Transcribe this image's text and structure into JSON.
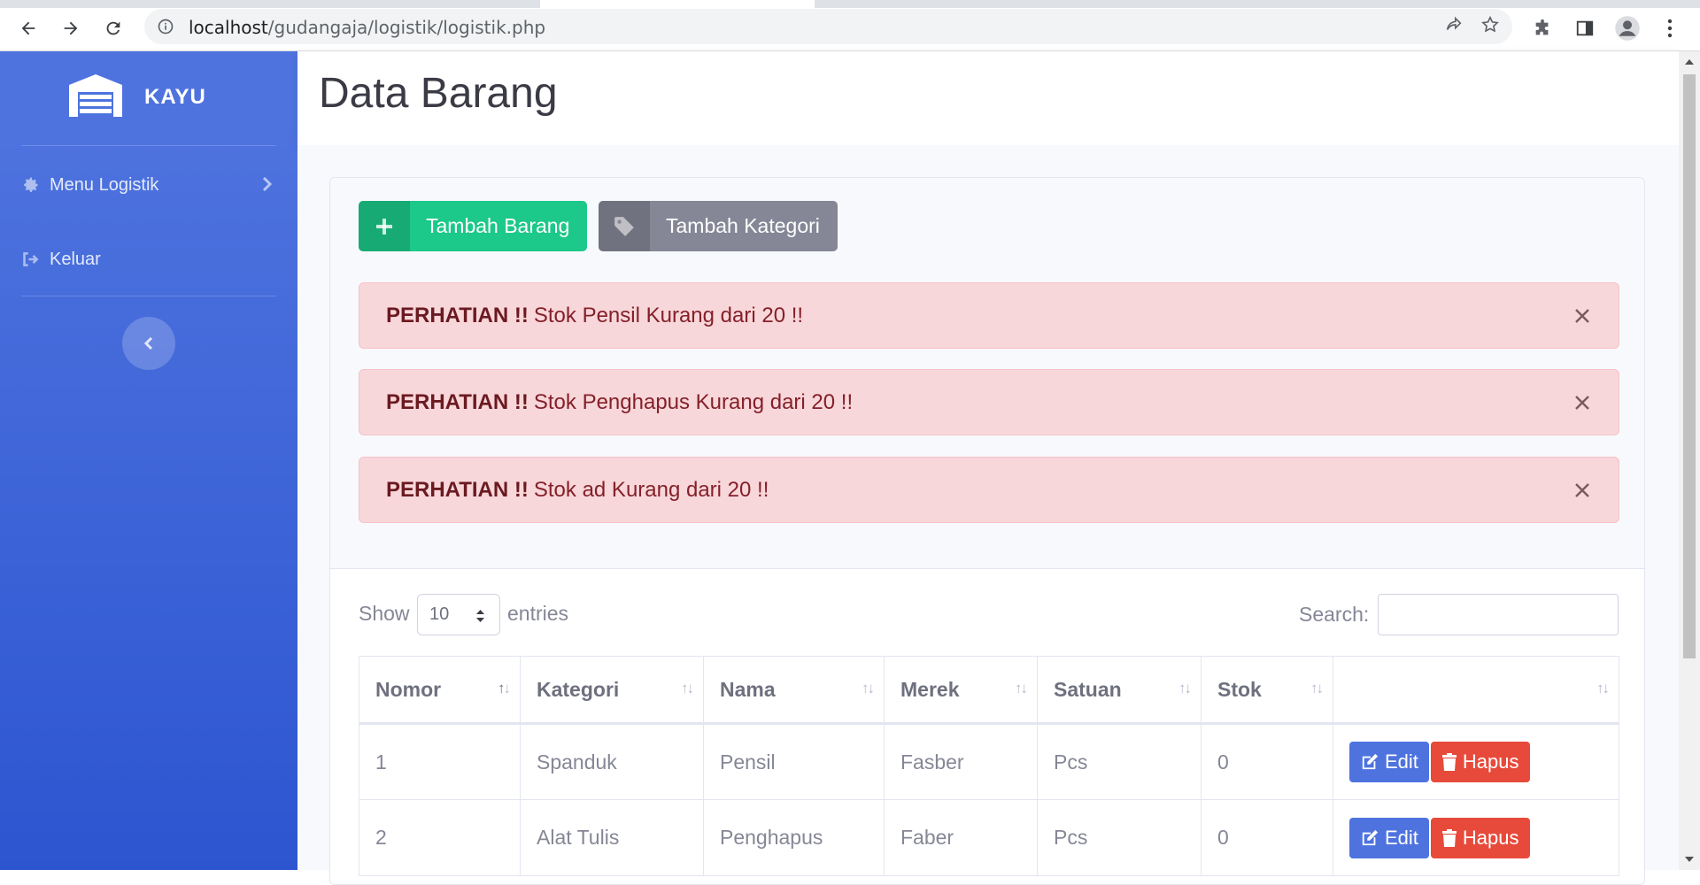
{
  "browser": {
    "url_host": "localhost",
    "url_path": "/gudangaja/logistik/logistik.php"
  },
  "sidebar": {
    "brand": "KAYU",
    "items": [
      {
        "label": "Menu Logistik",
        "icon": "gear-icon"
      },
      {
        "label": "Keluar",
        "icon": "sign-out-icon"
      }
    ]
  },
  "header": {
    "title": "Data Barang"
  },
  "actions": {
    "add_item": "Tambah Barang",
    "add_category": "Tambah Kategori"
  },
  "alerts": [
    {
      "strong": "PERHATIAN !!",
      "text": "Stok Pensil Kurang dari 20 !!"
    },
    {
      "strong": "PERHATIAN !!",
      "text": "Stok Penghapus Kurang dari 20 !!"
    },
    {
      "strong": "PERHATIAN !!",
      "text": "Stok ad Kurang dari 20 !!"
    }
  ],
  "table_controls": {
    "show": "Show",
    "entries_value": "10",
    "entries": "entries",
    "search": "Search:"
  },
  "table": {
    "columns": [
      "Nomor",
      "Kategori",
      "Nama",
      "Merek",
      "Satuan",
      "Stok",
      ""
    ],
    "rows": [
      [
        "1",
        "Spanduk",
        "Pensil",
        "Fasber",
        "Pcs",
        "0"
      ],
      [
        "2",
        "Alat Tulis",
        "Penghapus",
        "Faber",
        "Pcs",
        "0"
      ]
    ],
    "edit_label": "Edit",
    "delete_label": "Hapus"
  },
  "colors": {
    "sidebar": "#4e73df",
    "success": "#1cc88a",
    "secondary": "#858796",
    "danger": "#e74a3b",
    "alert_bg": "#f8d7da"
  }
}
